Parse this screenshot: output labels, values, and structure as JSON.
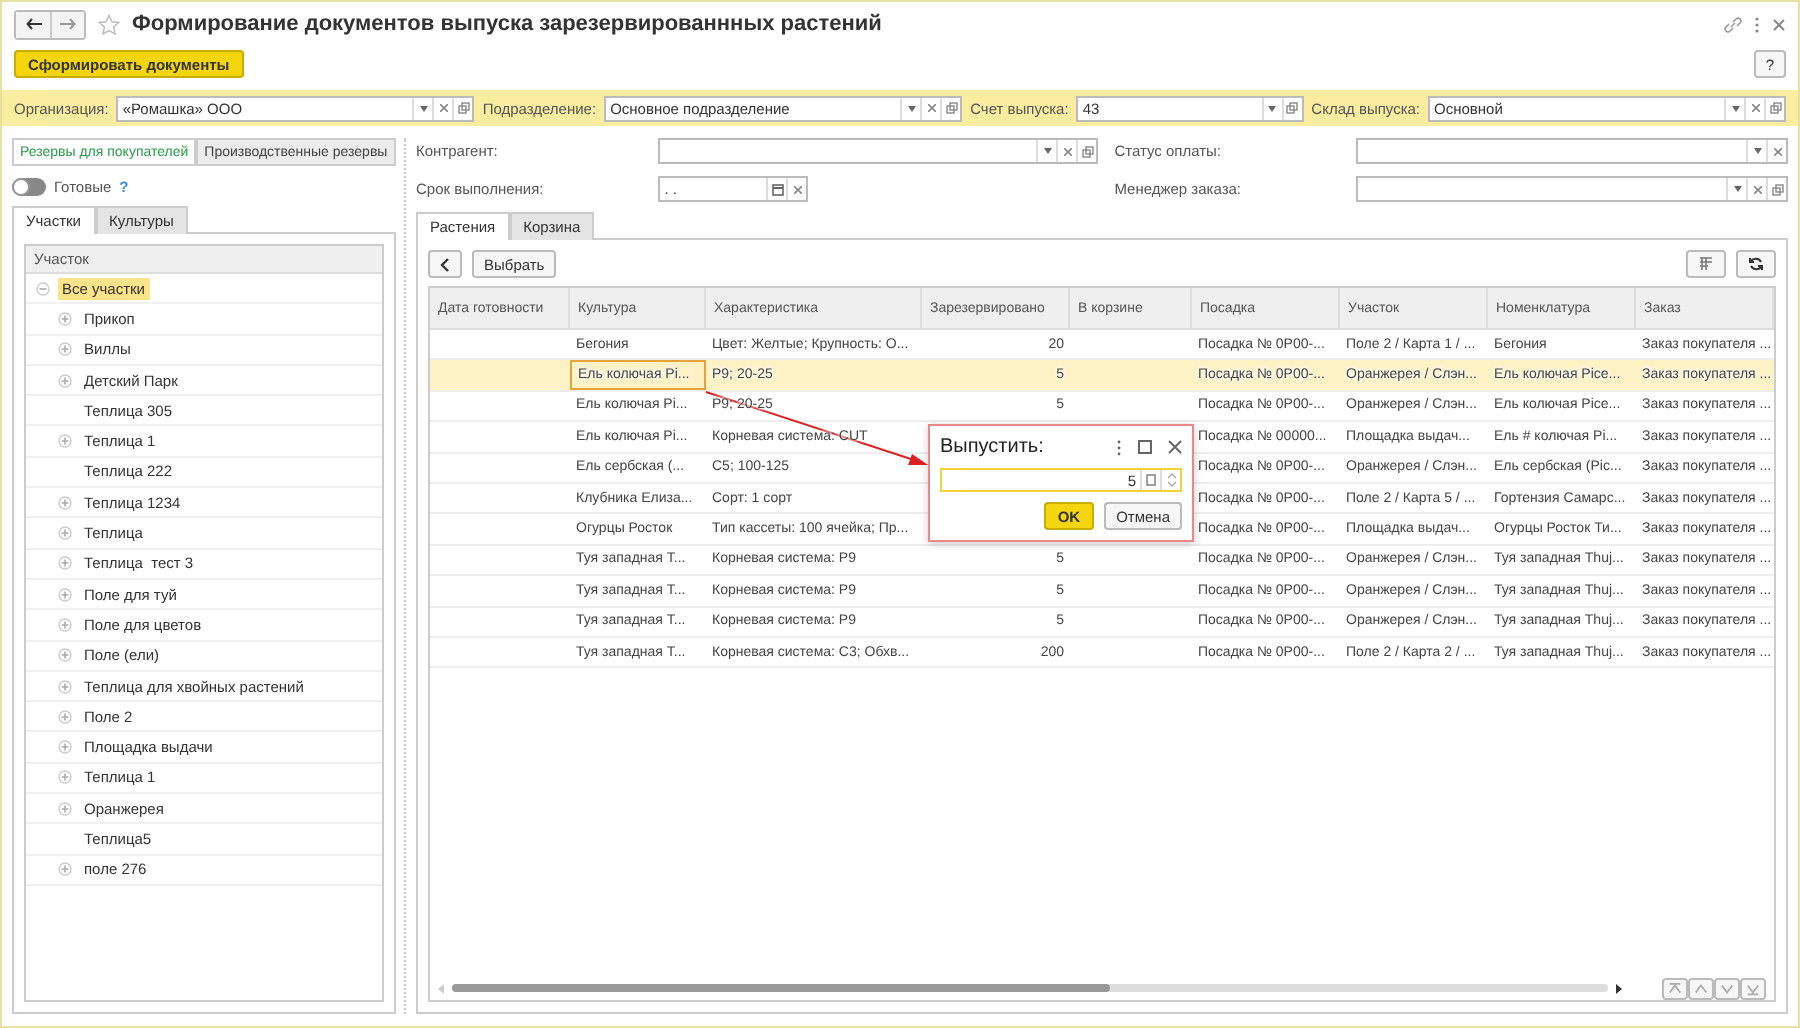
{
  "window": {
    "title": "Формирование документов выпуска зарезервированнных растений",
    "help": "?"
  },
  "main_button": "Сформировать документы",
  "filters": [
    {
      "label": "Организация:",
      "value": "«Ромашка» ООО",
      "kind": "wide"
    },
    {
      "label": "Подразделение:",
      "value": "Основное подразделение",
      "kind": "wide"
    },
    {
      "label": "Счет выпуска:",
      "value": "43",
      "kind": "narrow"
    },
    {
      "label": "Склад выпуска:",
      "value": "Основной",
      "kind": "wide"
    }
  ],
  "reserve_tabs": [
    {
      "label": "Резервы для покупателей",
      "selected": true
    },
    {
      "label": "Производственные резервы",
      "selected": false
    }
  ],
  "ready_toggle": {
    "label": "Готовые",
    "on": false,
    "hint": "?"
  },
  "left_tabs": [
    {
      "label": "Участки",
      "selected": true
    },
    {
      "label": "Культуры",
      "selected": false
    }
  ],
  "tree": {
    "header": "Участок",
    "items": [
      {
        "label": "Все участки",
        "kind": "group",
        "expanded": true,
        "selected": true,
        "children": [
          {
            "label": "Прикоп",
            "kind": "group",
            "expanded": false,
            "selected": false
          },
          {
            "label": "Виллы",
            "kind": "group",
            "expanded": false,
            "selected": false
          },
          {
            "label": "Детский Парк",
            "kind": "group",
            "expanded": false,
            "selected": false
          },
          {
            "label": "Теплица 305",
            "kind": "leaf",
            "selected": false
          },
          {
            "label": "Теплица 1",
            "kind": "group",
            "expanded": false,
            "selected": false
          },
          {
            "label": "Теплица 222",
            "kind": "leaf",
            "selected": false
          },
          {
            "label": "Теплица 1234",
            "kind": "group",
            "expanded": false,
            "selected": false
          },
          {
            "label": "Теплица",
            "kind": "group",
            "expanded": false,
            "selected": false
          },
          {
            "label": "Теплица  тест 3",
            "kind": "group",
            "expanded": false,
            "selected": false
          },
          {
            "label": "Поле для туй",
            "kind": "group",
            "expanded": false,
            "selected": false
          },
          {
            "label": "Поле для цветов",
            "kind": "group",
            "expanded": false,
            "selected": false
          },
          {
            "label": "Поле (ели)",
            "kind": "group",
            "expanded": false,
            "selected": false
          },
          {
            "label": "Теплица для хвойных растений",
            "kind": "group",
            "expanded": false,
            "selected": false
          },
          {
            "label": "Поле 2",
            "kind": "group",
            "expanded": false,
            "selected": false
          },
          {
            "label": "Площадка выдачи",
            "kind": "group",
            "expanded": false,
            "selected": false
          },
          {
            "label": "Теплица 1",
            "kind": "group",
            "expanded": false,
            "selected": false
          },
          {
            "label": "Оранжерея",
            "kind": "group",
            "expanded": false,
            "selected": false
          },
          {
            "label": "Теплица5",
            "kind": "leaf",
            "selected": false
          },
          {
            "label": "поле 276",
            "kind": "group",
            "expanded": false,
            "selected": false
          }
        ]
      }
    ]
  },
  "right_filters": [
    {
      "label": "Контрагент:",
      "kind": "combo"
    },
    {
      "label": "Статус оплаты:",
      "kind": "select"
    },
    {
      "label": "Срок выполнения:",
      "kind": "date",
      "placeholder": ". ."
    },
    {
      "label": "Менеджер заказа:",
      "kind": "combo"
    }
  ],
  "right_tabs": [
    {
      "label": "Растения",
      "selected": true
    },
    {
      "label": "Корзина",
      "selected": false
    }
  ],
  "toolbar": {
    "select_button": "Выбрать"
  },
  "table": {
    "columns": [
      "Дата готовности",
      "Культура",
      "Характеристика",
      "Зарезервировано",
      "В корзине",
      "Посадка",
      "Участок",
      "Номенклатура",
      "Заказ"
    ],
    "rows": [
      {
        "selected": false,
        "cells": [
          "",
          "Бегония",
          "Цвет: Желтые; Крупность: О...",
          "20",
          "",
          "Посадка № 0Р00-...",
          "Поле 2 / Карта 1 / ...",
          "Бегония",
          "Заказ покупателя ..."
        ]
      },
      {
        "selected": true,
        "cells": [
          "",
          "Ель колючая Pi...",
          "Р9; 20-25",
          "5",
          "",
          "Посадка № 0Р00-...",
          "Оранжерея / Слэн...",
          "Ель колючая Pice...",
          "Заказ покупателя ..."
        ]
      },
      {
        "selected": false,
        "cells": [
          "",
          "Ель колючая Pi...",
          "Р9; 20-25",
          "5",
          "",
          "Посадка № 0Р00-...",
          "Оранжерея / Слэн...",
          "Ель колючая Pice...",
          "Заказ покупателя ..."
        ]
      },
      {
        "selected": false,
        "cells": [
          "",
          "Ель колючая Pi...",
          "Корневая система: CUT",
          "",
          "",
          "Посадка № 00000...",
          "Площадка выдач...",
          "Ель # колючая Pi...",
          "Заказ покупателя ..."
        ]
      },
      {
        "selected": false,
        "cells": [
          "",
          "Ель сербская (...",
          "С5; 100-125",
          "",
          "",
          "Посадка № 0Р00-...",
          "Оранжерея / Слэн...",
          "Ель сербская (Pic...",
          "Заказ покупателя ..."
        ]
      },
      {
        "selected": false,
        "cells": [
          "",
          "Клубника Елиза...",
          "Сорт: 1 сорт",
          "",
          "",
          "Посадка № 0Р00-...",
          "Поле 2 / Карта 5 / ...",
          "Гортензия Самарс...",
          "Заказ покупателя ..."
        ]
      },
      {
        "selected": false,
        "cells": [
          "",
          "Огурцы Росток",
          "Тип кассеты: 100 ячейка; Пр...",
          "",
          "",
          "Посадка № 0Р00-...",
          "Площадка выдач...",
          "Огурцы Росток Ти...",
          "Заказ покупателя ..."
        ]
      },
      {
        "selected": false,
        "cells": [
          "",
          "Туя западная Т...",
          "Корневая система: Р9",
          "5",
          "",
          "Посадка № 0Р00-...",
          "Оранжерея / Слэн...",
          "Туя западная Thuj...",
          "Заказ покупателя ..."
        ]
      },
      {
        "selected": false,
        "cells": [
          "",
          "Туя западная Т...",
          "Корневая система: Р9",
          "5",
          "",
          "Посадка № 0Р00-...",
          "Оранжерея / Слэн...",
          "Туя западная Thuj...",
          "Заказ покупателя ..."
        ]
      },
      {
        "selected": false,
        "cells": [
          "",
          "Туя западная Т...",
          "Корневая система: Р9",
          "5",
          "",
          "Посадка № 0Р00-...",
          "Оранжерея / Слэн...",
          "Туя западная Thuj...",
          "Заказ покупателя ..."
        ]
      },
      {
        "selected": false,
        "cells": [
          "",
          "Туя западная Т...",
          "Корневая система: С3; Обхв...",
          "200",
          "",
          "Посадка № 0Р00-...",
          "Поле 2 / Карта 2 / ...",
          "Туя западная Thuj...",
          "Заказ покупателя ..."
        ]
      }
    ]
  },
  "dialog": {
    "title": "Выпустить:",
    "value": "5",
    "ok": "OK",
    "cancel": "Отмена"
  }
}
